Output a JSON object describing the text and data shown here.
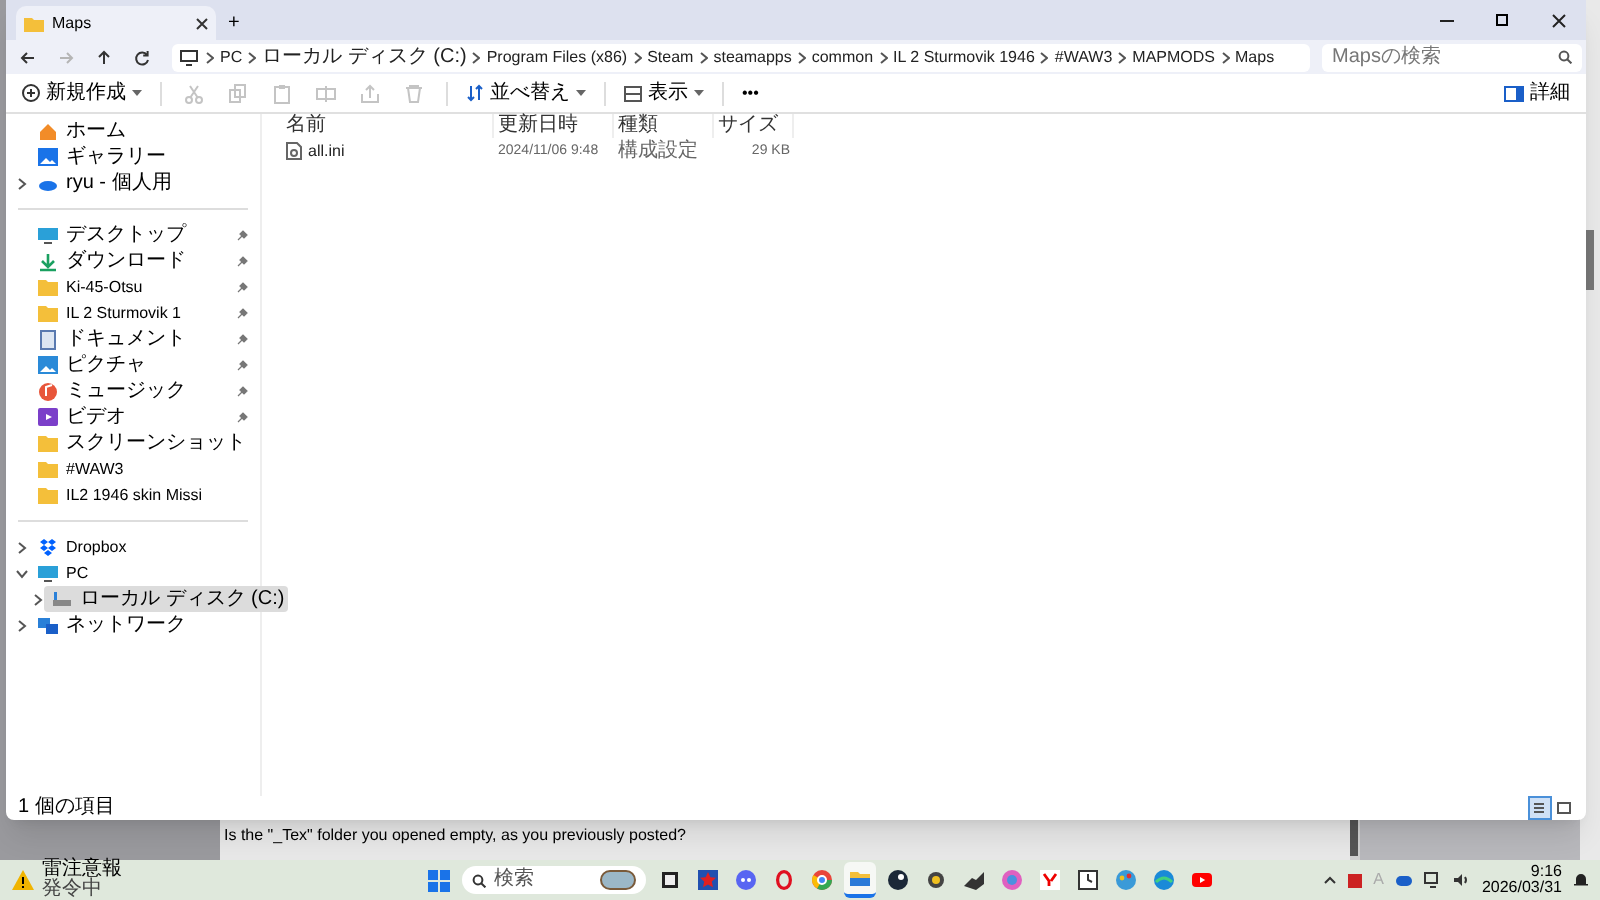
{
  "window": {
    "tab_title": "Maps",
    "new_tab": "+"
  },
  "nav": [
    {
      "kind": "back",
      "disabled": false
    },
    {
      "kind": "forward",
      "disabled": true
    },
    {
      "kind": "up",
      "disabled": false
    },
    {
      "kind": "refresh",
      "disabled": false
    }
  ],
  "breadcrumb": [
    "PC",
    "ローカル ディスク (C:)",
    "Program Files (x86)",
    "Steam",
    "steamapps",
    "common",
    "IL 2 Sturmovik 1946",
    "#WAW3",
    "MAPMODS",
    "Maps"
  ],
  "search": {
    "placeholder": "Mapsの検索"
  },
  "toolbar": {
    "new": "新規作成",
    "actions": [
      {
        "kind": "cut",
        "disabled": true
      },
      {
        "kind": "copy",
        "disabled": true
      },
      {
        "kind": "paste",
        "disabled": true
      },
      {
        "kind": "rename",
        "disabled": true
      },
      {
        "kind": "share",
        "disabled": true
      },
      {
        "kind": "delete",
        "disabled": true
      }
    ],
    "sort": "並べ替え",
    "view": "表示",
    "more": "•••",
    "details": "詳細"
  },
  "sidebar": {
    "sections": [
      [
        {
          "label": "ホーム",
          "kind": "home",
          "pinned": false
        },
        {
          "label": "ギャラリー",
          "kind": "gallery",
          "pinned": false
        },
        {
          "label": "ryu - 個人用",
          "kind": "cloud",
          "pinned": false,
          "expandable": true
        }
      ],
      [
        {
          "label": "デスクトップ",
          "kind": "desktop",
          "pinned": true
        },
        {
          "label": "ダウンロード",
          "kind": "download",
          "pinned": true
        },
        {
          "label": "Ki-45-Otsu",
          "kind": "folder",
          "pinned": true
        },
        {
          "label": "IL 2 Sturmovik 1",
          "kind": "folder",
          "pinned": true
        },
        {
          "label": "ドキュメント",
          "kind": "document",
          "pinned": true
        },
        {
          "label": "ピクチャ",
          "kind": "picture",
          "pinned": true
        },
        {
          "label": "ミュージック",
          "kind": "music",
          "pinned": true
        },
        {
          "label": "ビデオ",
          "kind": "video",
          "pinned": true
        },
        {
          "label": "スクリーンショット",
          "kind": "folder",
          "pinned": false
        },
        {
          "label": "#WAW3",
          "kind": "folder",
          "pinned": false
        },
        {
          "label": "IL2 1946 skin Missi",
          "kind": "folder",
          "pinned": false
        }
      ],
      [
        {
          "label": "Dropbox",
          "kind": "dropbox",
          "expandable": true,
          "expanded": false,
          "selected": false
        },
        {
          "label": "PC",
          "kind": "pc",
          "expandable": true,
          "expanded": true,
          "selected": false,
          "children": [
            {
              "label": "ローカル ディスク (C:)",
              "kind": "drive",
              "expandable": true,
              "expanded": false,
              "selected": true
            }
          ]
        },
        {
          "label": "ネットワーク",
          "kind": "network",
          "expandable": true,
          "expanded": false,
          "selected": false
        }
      ]
    ]
  },
  "table": {
    "columns": [
      "名前",
      "更新日時",
      "種類",
      "サイズ"
    ],
    "rows": [
      [
        "all.ini",
        "2024/11/06 9:48",
        "構成設定",
        "29 KB"
      ]
    ]
  },
  "status_bar": {
    "count": "1 個の項目",
    "views": [
      {
        "kind": "details",
        "selected": true
      },
      {
        "kind": "tiles",
        "selected": false
      }
    ]
  },
  "background_page": {
    "text": "Is the \"_Tex\" folder you opened empty, as you previously posted?"
  },
  "taskbar": {
    "weather": {
      "title": "雷注意報",
      "subtitle": "発令中"
    },
    "search": {
      "placeholder": "検索"
    },
    "apps": [
      {
        "kind": "task-view",
        "selected": false
      },
      {
        "kind": "star",
        "selected": false
      },
      {
        "kind": "chat",
        "selected": false
      },
      {
        "kind": "ring",
        "selected": false
      },
      {
        "kind": "browser",
        "selected": false
      },
      {
        "kind": "folder",
        "selected": true
      },
      {
        "kind": "dark-circle",
        "selected": false
      },
      {
        "kind": "round",
        "selected": false
      },
      {
        "kind": "tool",
        "selected": false
      },
      {
        "kind": "swirl",
        "selected": false
      },
      {
        "kind": "yahoo",
        "selected": false
      },
      {
        "kind": "clock",
        "selected": false
      },
      {
        "kind": "palette",
        "selected": false
      },
      {
        "kind": "wave",
        "selected": false
      },
      {
        "kind": "play",
        "selected": false
      }
    ],
    "ime": "A",
    "time": "9:16",
    "date": "2026/03/31"
  }
}
